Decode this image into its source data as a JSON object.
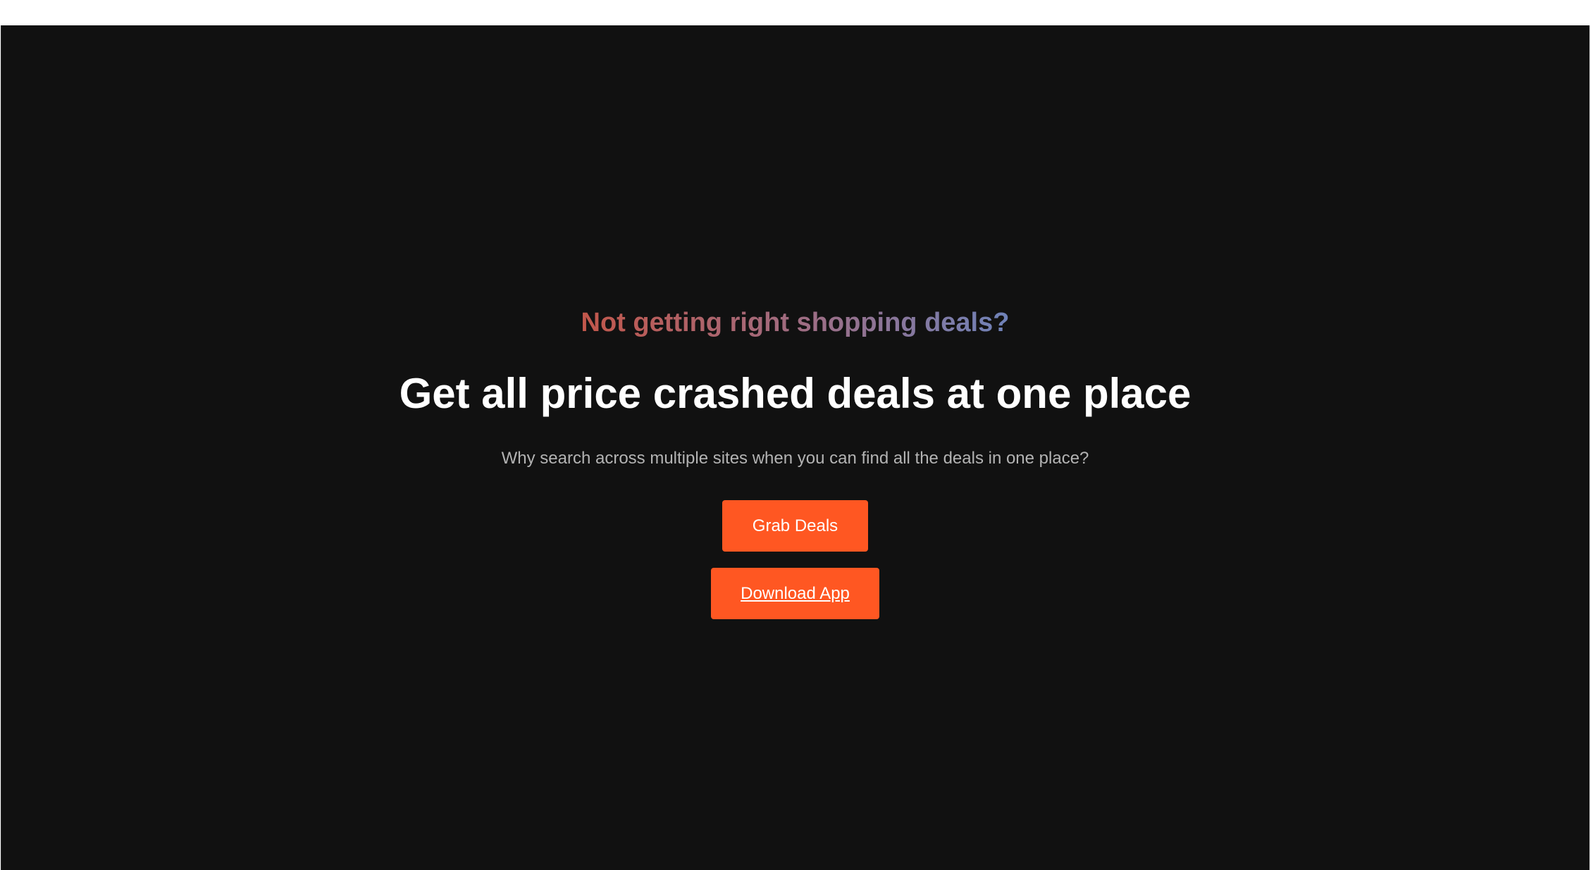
{
  "hero": {
    "eyebrow": "Not getting right shopping deals?",
    "headline": "Get all price crashed deals at one place",
    "subtext": "Why search across multiple sites when you can find all the deals in one place?",
    "grab_button_label": "Grab Deals",
    "download_button_label": "Download App"
  },
  "colors": {
    "background": "#111111",
    "accent": "#ff5722",
    "eyebrow_gradient_start": "#c2574b",
    "eyebrow_gradient_end": "#6f82b8"
  }
}
